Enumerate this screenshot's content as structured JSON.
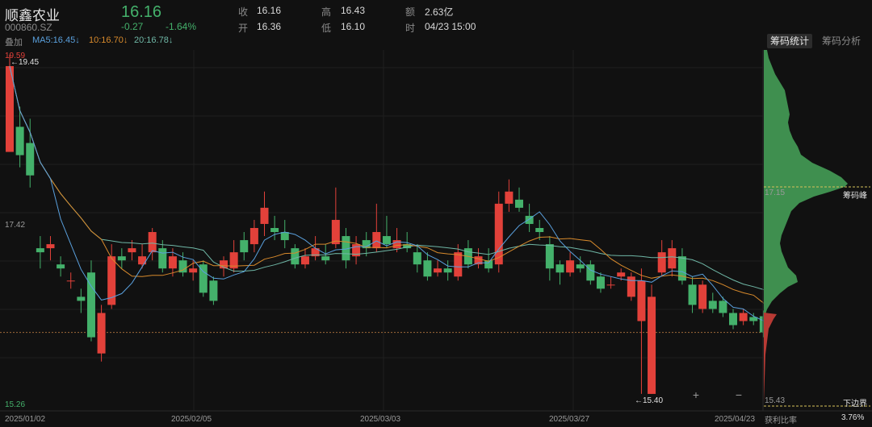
{
  "stock": {
    "name": "顺鑫农业",
    "code": "000860.SZ",
    "price": "16.16",
    "change": "-0.27",
    "change_pct": "-1.64%"
  },
  "stats": {
    "close_label": "收",
    "close_value": "16.16",
    "open_label": "开",
    "open_value": "16.36",
    "high_label": "高",
    "high_value": "16.43",
    "low_label": "低",
    "low_value": "16.10",
    "amount_label": "额",
    "amount_value": "2.63亿",
    "time_label": "时",
    "time_value": "04/23 15:00"
  },
  "indicators": {
    "overlay_label": "叠加",
    "ma5": "MA5:16.45↓",
    "ma10": "10:16.70↓",
    "ma20": "20:16.78↓"
  },
  "tabs": {
    "chip_stats": "筹码统计",
    "chip_analysis": "筹码分析"
  },
  "axis": {
    "top_price": "19.59",
    "mid_price": "17.42",
    "bottom_price": "15.26",
    "high_marker": "←19.45",
    "low_marker": "←15.40"
  },
  "dates": [
    "2025/01/02",
    "2025/02/05",
    "2025/03/03",
    "2025/03/27",
    "2025/04/23"
  ],
  "chip_panel": {
    "peak_price": "17.15",
    "peak_label": "筹码峰",
    "lower_price": "15.43",
    "lower_label": "下边界",
    "profit_label": "获利比率",
    "profit_value": "3.76%"
  },
  "controls": {
    "zoom_in": "+",
    "zoom_out": "−"
  },
  "colors": {
    "up": "#e2413a",
    "down": "#44b16b",
    "ma5": "#5aa0dd",
    "ma10": "#d88a2c",
    "ma20": "#6fb7a6"
  },
  "chart_data": {
    "type": "candlestick",
    "y_range": [
      15.26,
      19.59
    ],
    "ohlc": [
      [
        18.39,
        19.45,
        19.59,
        18.39
      ],
      [
        18.7,
        18.35,
        18.95,
        18.2
      ],
      [
        18.5,
        18.1,
        18.8,
        17.95
      ],
      [
        17.2,
        17.15,
        17.35,
        16.95
      ],
      [
        17.2,
        17.25,
        17.35,
        17.05
      ],
      [
        17.0,
        16.95,
        17.1,
        16.85
      ],
      [
        16.8,
        16.8,
        16.9,
        16.7
      ],
      [
        16.6,
        16.55,
        16.7,
        16.4
      ],
      [
        16.9,
        16.1,
        17.05,
        16.05
      ],
      [
        15.9,
        16.4,
        16.5,
        15.8
      ],
      [
        16.5,
        17.1,
        17.25,
        16.45
      ],
      [
        17.1,
        17.05,
        17.2,
        16.95
      ],
      [
        17.15,
        17.2,
        17.3,
        17.05
      ],
      [
        17.0,
        17.1,
        17.25,
        16.95
      ],
      [
        17.15,
        17.4,
        17.45,
        17.05
      ],
      [
        17.2,
        16.95,
        17.3,
        16.9
      ],
      [
        16.95,
        17.1,
        17.2,
        16.85
      ],
      [
        17.05,
        16.9,
        17.15,
        16.85
      ],
      [
        16.9,
        16.95,
        17.05,
        16.8
      ],
      [
        17.0,
        16.65,
        17.05,
        16.6
      ],
      [
        16.8,
        16.55,
        16.85,
        16.5
      ],
      [
        16.95,
        17.05,
        17.1,
        16.85
      ],
      [
        16.95,
        17.15,
        17.3,
        16.9
      ],
      [
        17.3,
        17.15,
        17.4,
        17.05
      ],
      [
        17.25,
        17.45,
        17.55,
        17.15
      ],
      [
        17.5,
        17.7,
        17.9,
        17.35
      ],
      [
        17.45,
        17.4,
        17.6,
        17.3
      ],
      [
        17.4,
        17.3,
        17.55,
        17.2
      ],
      [
        17.2,
        17.0,
        17.25,
        16.95
      ],
      [
        17.0,
        17.1,
        17.2,
        16.95
      ],
      [
        17.1,
        17.2,
        17.35,
        17.05
      ],
      [
        17.1,
        17.05,
        17.25,
        17.0
      ],
      [
        17.25,
        17.55,
        17.95,
        17.2
      ],
      [
        17.35,
        17.05,
        17.45,
        16.95
      ],
      [
        17.1,
        17.25,
        17.35,
        17.0
      ],
      [
        17.3,
        17.2,
        17.4,
        17.1
      ],
      [
        17.2,
        17.4,
        17.75,
        17.15
      ],
      [
        17.35,
        17.25,
        17.6,
        17.2
      ],
      [
        17.2,
        17.3,
        17.45,
        17.15
      ],
      [
        17.25,
        17.2,
        17.4,
        17.15
      ],
      [
        17.15,
        17.0,
        17.25,
        16.9
      ],
      [
        17.05,
        16.85,
        17.15,
        16.8
      ],
      [
        16.9,
        16.95,
        17.05,
        16.85
      ],
      [
        16.95,
        16.9,
        17.05,
        16.8
      ],
      [
        16.85,
        17.15,
        17.25,
        16.8
      ],
      [
        17.2,
        17.0,
        17.3,
        16.95
      ],
      [
        17.0,
        17.1,
        17.2,
        16.95
      ],
      [
        17.05,
        16.95,
        17.2,
        16.9
      ],
      [
        17.0,
        17.75,
        17.9,
        16.9
      ],
      [
        17.75,
        17.9,
        18.05,
        17.65
      ],
      [
        17.8,
        17.7,
        17.95,
        17.65
      ],
      [
        17.6,
        17.5,
        17.75,
        17.4
      ],
      [
        17.45,
        17.4,
        17.55,
        17.3
      ],
      [
        17.25,
        16.95,
        17.35,
        16.8
      ],
      [
        17.0,
        16.9,
        17.05,
        16.75
      ],
      [
        16.9,
        17.05,
        17.15,
        16.85
      ],
      [
        17.0,
        16.95,
        17.1,
        16.9
      ],
      [
        17.0,
        16.8,
        17.05,
        16.75
      ],
      [
        16.85,
        16.7,
        16.9,
        16.65
      ],
      [
        16.75,
        16.75,
        16.85,
        16.7
      ],
      [
        16.85,
        16.9,
        16.95,
        16.8
      ],
      [
        16.6,
        16.85,
        16.9,
        16.55
      ],
      [
        16.3,
        16.8,
        16.95,
        15.4
      ],
      [
        15.4,
        16.6,
        16.75,
        15.4
      ],
      [
        16.9,
        17.15,
        17.3,
        16.85
      ],
      [
        16.95,
        17.2,
        17.3,
        16.85
      ],
      [
        17.1,
        16.8,
        17.2,
        16.75
      ],
      [
        16.75,
        16.5,
        16.85,
        16.4
      ],
      [
        16.45,
        16.75,
        16.8,
        16.4
      ],
      [
        16.55,
        16.45,
        16.65,
        16.4
      ],
      [
        16.55,
        16.4,
        16.6,
        16.35
      ],
      [
        16.4,
        16.25,
        16.45,
        16.2
      ],
      [
        16.3,
        16.4,
        16.45,
        16.25
      ],
      [
        16.35,
        16.3,
        16.4,
        16.25
      ],
      [
        16.36,
        16.16,
        16.43,
        16.1
      ]
    ]
  }
}
